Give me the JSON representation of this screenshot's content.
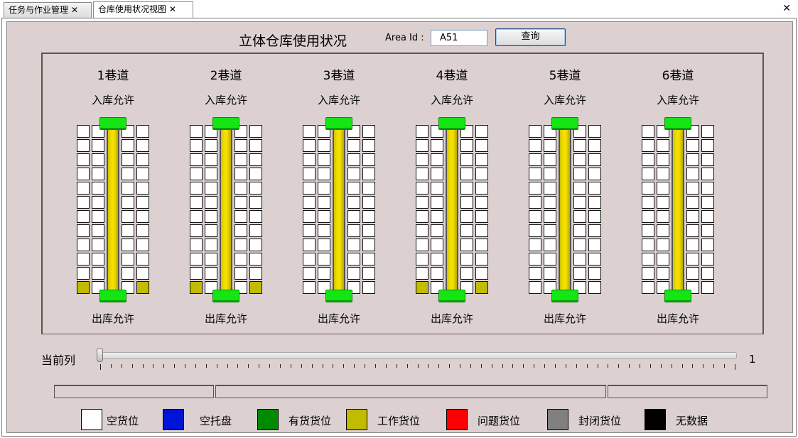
{
  "tabs": [
    {
      "label": "任务与作业管理",
      "close": "✕"
    },
    {
      "label": "仓库使用状况视图",
      "close": "✕"
    }
  ],
  "window_close": "✕",
  "header": {
    "title": "立体仓库使用状况",
    "area_label": "Area Id :",
    "area_value": "A51",
    "query_label": "查询"
  },
  "lanes": [
    {
      "name": "1巷道",
      "in_label": "入库允许",
      "out_label": "出库允许",
      "work_bottom": true
    },
    {
      "name": "2巷道",
      "in_label": "入库允许",
      "out_label": "出库允许",
      "work_bottom": true
    },
    {
      "name": "3巷道",
      "in_label": "入库允许",
      "out_label": "出库允许",
      "work_bottom": false
    },
    {
      "name": "4巷道",
      "in_label": "入库允许",
      "out_label": "出库允许",
      "work_bottom": true
    },
    {
      "name": "5巷道",
      "in_label": "入库允许",
      "out_label": "出库允许",
      "work_bottom": false
    },
    {
      "name": "6巷道",
      "in_label": "入库允许",
      "out_label": "出库允许",
      "work_bottom": false
    }
  ],
  "current_column": {
    "label": "当前列",
    "value": "1",
    "slider_position": 0
  },
  "legend": [
    {
      "label": "空货位",
      "color": "#ffffff"
    },
    {
      "label": "空托盘",
      "color": "#0014d8"
    },
    {
      "label": "有货货位",
      "color": "#008a00"
    },
    {
      "label": "工作货位",
      "color": "#c2bc00"
    },
    {
      "label": "问题货位",
      "color": "#ff0000"
    },
    {
      "label": "封闭货位",
      "color": "#808080"
    },
    {
      "label": "无数据",
      "color": "#000000"
    }
  ]
}
